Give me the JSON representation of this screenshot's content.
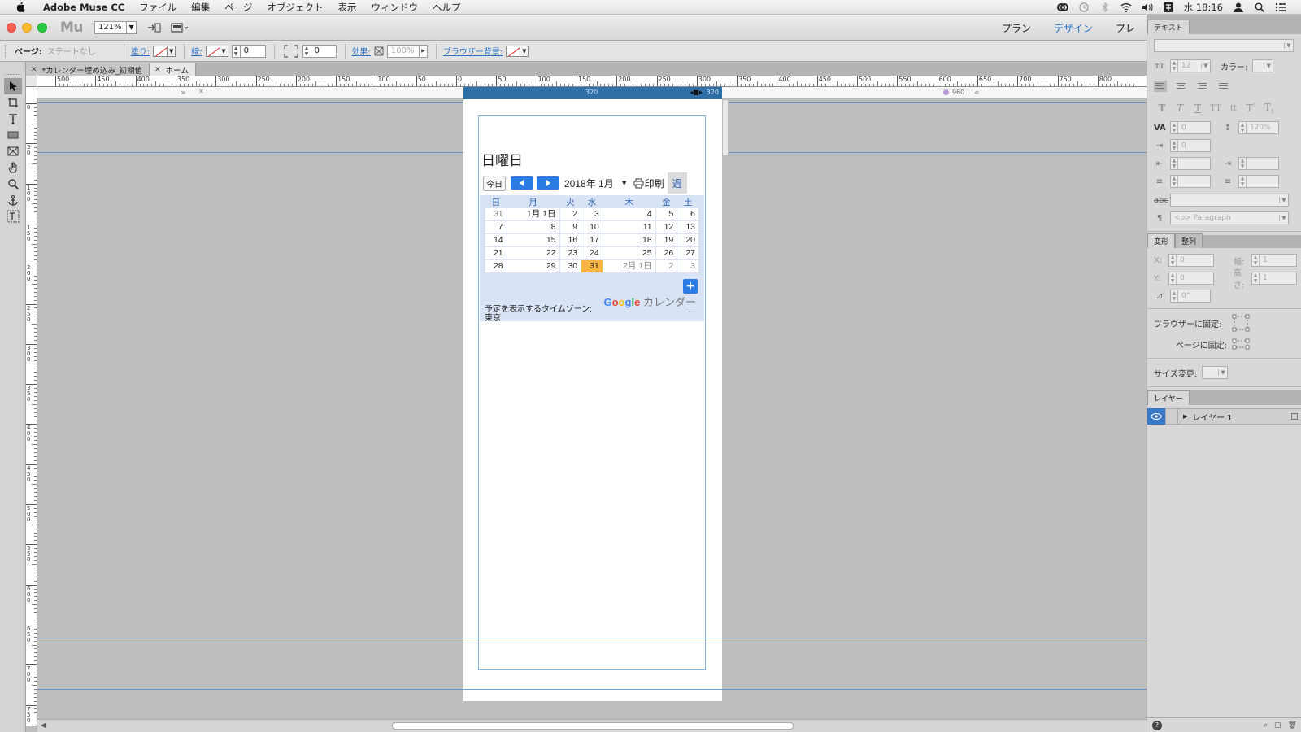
{
  "menubar": {
    "app_name": "Adobe Muse CC",
    "items": [
      "ファイル",
      "編集",
      "ページ",
      "オブジェクト",
      "表示",
      "ウィンドウ",
      "ヘルプ"
    ],
    "clock": "水 18:16"
  },
  "appbar": {
    "logo": "Mu",
    "zoom": "121%",
    "modes": [
      "プラン",
      "デザイン",
      "プレ"
    ],
    "active_mode": "デザイン"
  },
  "controlbar": {
    "page_label": "ページ:",
    "page_state": "ステートなし",
    "fill_label": "塗り:",
    "stroke_label": "線:",
    "stroke_value": "0",
    "corner_value": "0",
    "effect_label": "効果:",
    "opacity_value": "100%",
    "browser_bg_label": "ブラウザー背景:"
  },
  "tabs": [
    {
      "label": "*カレンダー埋め込み_初期値",
      "active": false
    },
    {
      "label": "ホーム",
      "active": true
    }
  ],
  "ruler": {
    "h_labels": [
      "500",
      "450",
      "400",
      "350",
      "300",
      "250",
      "200",
      "150",
      "100",
      "50",
      "0",
      "50",
      "100",
      "150",
      "200",
      "250",
      "300",
      "350",
      "400",
      "450",
      "500",
      "550",
      "600",
      "650",
      "700",
      "750",
      "800"
    ],
    "v_labels": [
      "0",
      "50",
      "100",
      "150",
      "200",
      "250",
      "300",
      "350",
      "400",
      "450",
      "500",
      "550",
      "600",
      "650",
      "700",
      "750"
    ]
  },
  "breakpoints": {
    "active_width": "320",
    "active_width_right": "320",
    "other": "960"
  },
  "calendar": {
    "day_title": "日曜日",
    "today": "今日",
    "month": "2018年 1月",
    "print": "印刷",
    "week": "週",
    "weekdays": [
      "日",
      "月",
      "火",
      "水",
      "木",
      "金",
      "土"
    ],
    "weeks": [
      [
        "31",
        "1月 1日",
        "2",
        "3",
        "4",
        "5",
        "6"
      ],
      [
        "7",
        "8",
        "9",
        "10",
        "11",
        "12",
        "13"
      ],
      [
        "14",
        "15",
        "16",
        "17",
        "18",
        "19",
        "20"
      ],
      [
        "21",
        "22",
        "23",
        "24",
        "25",
        "26",
        "27"
      ],
      [
        "28",
        "29",
        "30",
        "31",
        "2月 1日",
        "2",
        "3"
      ]
    ],
    "google": "Google",
    "calendar_word": "カレンダー",
    "timezone": "予定を表示するタイムゾーン: 東京",
    "dash": "—"
  },
  "right_panel": {
    "text_tab": "テキスト",
    "font_size": "12",
    "color_label": "カラー:",
    "tracking": "0",
    "leading": "120%",
    "indent": "0",
    "paragraph": "<p> Paragraph",
    "transform_tab": "変形",
    "align_tab": "整列",
    "x_label": "X:",
    "x_value": "0",
    "y_label": "Y:",
    "y_value": "0",
    "w_label": "幅:",
    "w_value": "1",
    "h_label": "高さ:",
    "h_value": "1",
    "rotation": "0°",
    "pin_browser": "ブラウザーに固定:",
    "pin_page": "ページに固定:",
    "resize": "サイズ変更:",
    "layers_tab": "レイヤー",
    "layer_name": "レイヤー 1"
  },
  "colors": {
    "accent_blue": "#2a7be4",
    "today_orange": "#f7b544",
    "breakpoint_blue": "#2f6fa8",
    "guide_blue": "#4a84c4"
  }
}
